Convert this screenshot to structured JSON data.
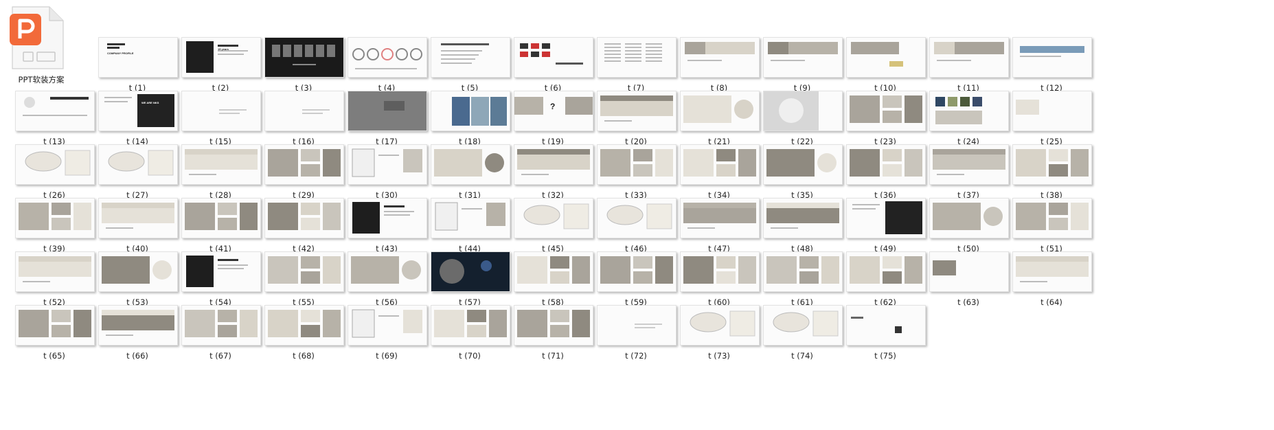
{
  "file_icon": {
    "name": "PPT软装方案",
    "icon": "ppt-file-icon",
    "accent": "#f26a3a"
  },
  "thumbs": [
    {
      "label": "t (1)",
      "style": "title",
      "text": "COMPANY PROFILE"
    },
    {
      "label": "t (2)",
      "style": "dark-left",
      "text": "15 years"
    },
    {
      "label": "t (3)",
      "style": "black-faces"
    },
    {
      "label": "t (4)",
      "style": "circles"
    },
    {
      "label": "t (5)",
      "style": "text-top"
    },
    {
      "label": "t (6)",
      "style": "logos"
    },
    {
      "label": "t (7)",
      "style": "text-cols"
    },
    {
      "label": "t (8)",
      "style": "photo-strip"
    },
    {
      "label": "t (9)",
      "style": "photo-strip"
    },
    {
      "label": "t (10)",
      "style": "photo-logo"
    },
    {
      "label": "t (11)",
      "style": "photo-strip"
    },
    {
      "label": "t (12)",
      "style": "blue-strip"
    },
    {
      "label": "t (13)",
      "style": "map-text"
    },
    {
      "label": "t (14)",
      "style": "dark-right",
      "text": "WE ARE NKS"
    },
    {
      "label": "t (15)",
      "style": "blank-text"
    },
    {
      "label": "t (16)",
      "style": "blank-text"
    },
    {
      "label": "t (17)",
      "style": "grey-full"
    },
    {
      "label": "t (18)",
      "style": "blue-photos"
    },
    {
      "label": "t (19)",
      "style": "photo-question",
      "text": "?"
    },
    {
      "label": "t (20)",
      "style": "photo-wide"
    },
    {
      "label": "t (21)",
      "style": "photo-circle"
    },
    {
      "label": "t (22)",
      "style": "ceiling"
    },
    {
      "label": "t (23)",
      "style": "photo-collage"
    },
    {
      "label": "t (24)",
      "style": "swatches"
    },
    {
      "label": "t (25)",
      "style": "small-photo"
    },
    {
      "label": "t (26)",
      "style": "plan"
    },
    {
      "label": "t (27)",
      "style": "plan"
    },
    {
      "label": "t (28)",
      "style": "photo-wide"
    },
    {
      "label": "t (29)",
      "style": "photo-collage"
    },
    {
      "label": "t (30)",
      "style": "sketch"
    },
    {
      "label": "t (31)",
      "style": "photo-circle"
    },
    {
      "label": "t (32)",
      "style": "photo-wide"
    },
    {
      "label": "t (33)",
      "style": "photo-collage"
    },
    {
      "label": "t (34)",
      "style": "photo-collage"
    },
    {
      "label": "t (35)",
      "style": "photo-circle"
    },
    {
      "label": "t (36)",
      "style": "photo-collage"
    },
    {
      "label": "t (37)",
      "style": "photo-wide"
    },
    {
      "label": "t (38)",
      "style": "photo-collage"
    },
    {
      "label": "t (39)",
      "style": "photo-collage"
    },
    {
      "label": "t (40)",
      "style": "photo-wide"
    },
    {
      "label": "t (41)",
      "style": "photo-collage"
    },
    {
      "label": "t (42)",
      "style": "photo-collage"
    },
    {
      "label": "t (43)",
      "style": "dark-left"
    },
    {
      "label": "t (44)",
      "style": "sketch"
    },
    {
      "label": "t (45)",
      "style": "plan"
    },
    {
      "label": "t (46)",
      "style": "plan"
    },
    {
      "label": "t (47)",
      "style": "photo-wide"
    },
    {
      "label": "t (48)",
      "style": "photo-wide"
    },
    {
      "label": "t (49)",
      "style": "dark-right"
    },
    {
      "label": "t (50)",
      "style": "photo-circle"
    },
    {
      "label": "t (51)",
      "style": "photo-collage"
    },
    {
      "label": "t (52)",
      "style": "photo-wide"
    },
    {
      "label": "t (53)",
      "style": "photo-circle"
    },
    {
      "label": "t (54)",
      "style": "dark-left"
    },
    {
      "label": "t (55)",
      "style": "photo-collage"
    },
    {
      "label": "t (56)",
      "style": "photo-circle"
    },
    {
      "label": "t (57)",
      "style": "dark-full"
    },
    {
      "label": "t (58)",
      "style": "photo-collage"
    },
    {
      "label": "t (59)",
      "style": "photo-collage"
    },
    {
      "label": "t (60)",
      "style": "photo-collage"
    },
    {
      "label": "t (61)",
      "style": "photo-collage"
    },
    {
      "label": "t (62)",
      "style": "photo-collage"
    },
    {
      "label": "t (63)",
      "style": "small-photo"
    },
    {
      "label": "t (64)",
      "style": "photo-wide"
    },
    {
      "label": "t (65)",
      "style": "photo-collage"
    },
    {
      "label": "t (66)",
      "style": "photo-wide"
    },
    {
      "label": "t (67)",
      "style": "photo-collage"
    },
    {
      "label": "t (68)",
      "style": "photo-collage"
    },
    {
      "label": "t (69)",
      "style": "sketch"
    },
    {
      "label": "t (70)",
      "style": "photo-collage"
    },
    {
      "label": "t (71)",
      "style": "photo-collage"
    },
    {
      "label": "t (72)",
      "style": "blank-text"
    },
    {
      "label": "t (73)",
      "style": "plan"
    },
    {
      "label": "t (74)",
      "style": "plan"
    },
    {
      "label": "t (75)",
      "style": "thanks"
    }
  ]
}
